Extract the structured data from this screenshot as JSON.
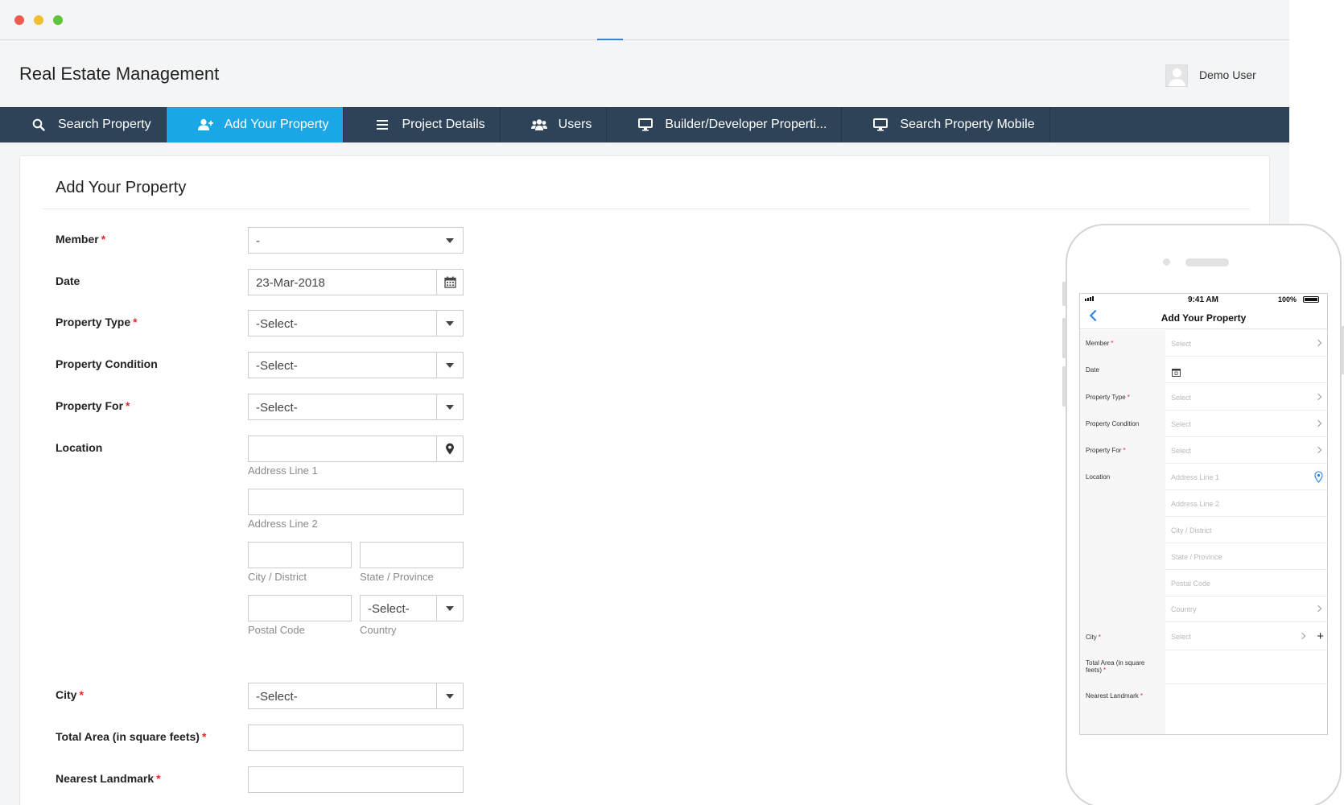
{
  "window": {
    "app_title": "Real Estate Management",
    "user_name": "Demo User"
  },
  "nav": {
    "items": [
      {
        "label": "Search Property",
        "icon": "search-icon"
      },
      {
        "label": "Add Your Property",
        "icon": "add-user-icon"
      },
      {
        "label": "Project Details",
        "icon": "list-icon"
      },
      {
        "label": "Users",
        "icon": "users-icon"
      },
      {
        "label": "Builder/Developer Properti...",
        "icon": "monitor-icon"
      },
      {
        "label": "Search Property Mobile",
        "icon": "monitor-icon"
      }
    ],
    "active_color": "#1ba6e5",
    "bar_color": "#2f4358"
  },
  "form": {
    "title": "Add Your Property",
    "member": {
      "label": "Member",
      "value": "-"
    },
    "date": {
      "label": "Date",
      "value": "23-Mar-2018"
    },
    "property_type": {
      "label": "Property Type",
      "value": "-Select-"
    },
    "property_condition": {
      "label": "Property Condition",
      "value": "-Select-"
    },
    "property_for": {
      "label": "Property For",
      "value": "-Select-"
    },
    "location": {
      "label": "Location",
      "address_line_1": "Address Line 1",
      "address_line_2": "Address Line 2",
      "city_district": "City / District",
      "state_province": "State / Province",
      "postal_code": "Postal Code",
      "country": "Country",
      "country_value": "-Select-"
    },
    "city": {
      "label": "City",
      "value": "-Select-"
    },
    "total_area": {
      "label": "Total Area (in square feets)"
    },
    "nearest_landmark": {
      "label": "Nearest Landmark"
    },
    "required_mark": "*"
  },
  "mobile": {
    "status_time": "9:41 AM",
    "battery": "100%",
    "title": "Add Your Property",
    "labels": {
      "member": "Member",
      "date": "Date",
      "property_type": "Property Type",
      "property_condition": "Property Condition",
      "property_for": "Property For",
      "location": "Location",
      "city": "City",
      "total_area": "Total Area (in square feets)",
      "nearest_landmark": "Nearest Landmark"
    },
    "placeholders": {
      "select": "Select",
      "address_line_1": "Address Line 1",
      "address_line_2": "Address Line 2",
      "city_district": "City / District",
      "state_province": "State / Province",
      "postal_code": "Postal Code",
      "country": "Country"
    },
    "accent_color": "#2a7de1"
  }
}
